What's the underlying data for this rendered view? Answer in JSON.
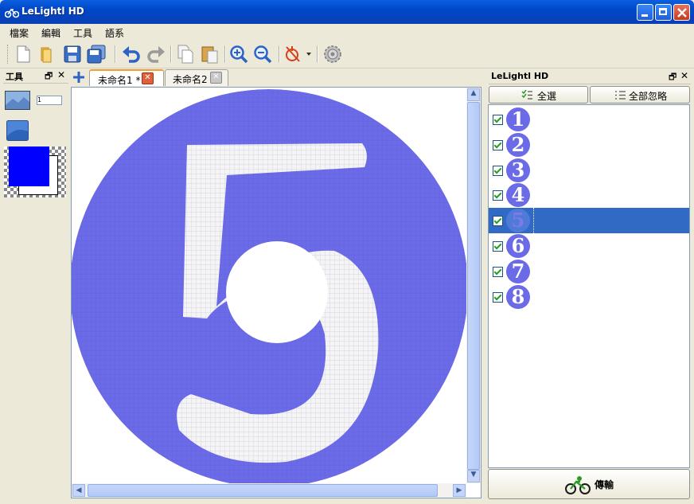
{
  "window": {
    "title": "LeLightl HD",
    "icon": "bicycle-icon"
  },
  "menu": [
    {
      "label": "檔案"
    },
    {
      "label": "編輯"
    },
    {
      "label": "工具"
    },
    {
      "label": "語系"
    }
  ],
  "toolbar": {
    "icons": [
      "new-file-icon",
      "open-folder-icon",
      "save-icon",
      "save-all-icon",
      "undo-icon",
      "redo-icon",
      "copy-icon",
      "paste-icon",
      "zoom-in-icon",
      "zoom-out-icon",
      "shape-tool-icon",
      "settings-gear-icon"
    ]
  },
  "tools_panel": {
    "title": "工具",
    "line_width_value": "1",
    "primary_color": "#0000ff",
    "secondary_color": "#ffffff"
  },
  "tabs": [
    {
      "label": "未命名1 *",
      "active": true
    },
    {
      "label": "未命名2",
      "active": false
    }
  ],
  "canvas": {
    "digit": "5",
    "fill_color": "#6b6be8",
    "background": "#ffffff"
  },
  "right_panel": {
    "title": "LeLightl HD",
    "select_all_label": "全選",
    "ignore_all_label": "全部忽略",
    "items": [
      {
        "number": "1",
        "checked": true,
        "selected": false
      },
      {
        "number": "2",
        "checked": true,
        "selected": false
      },
      {
        "number": "3",
        "checked": true,
        "selected": false
      },
      {
        "number": "4",
        "checked": true,
        "selected": false
      },
      {
        "number": "5",
        "checked": true,
        "selected": true
      },
      {
        "number": "6",
        "checked": true,
        "selected": false
      },
      {
        "number": "7",
        "checked": true,
        "selected": false
      },
      {
        "number": "8",
        "checked": true,
        "selected": false
      }
    ],
    "send_label": "傳輸"
  }
}
